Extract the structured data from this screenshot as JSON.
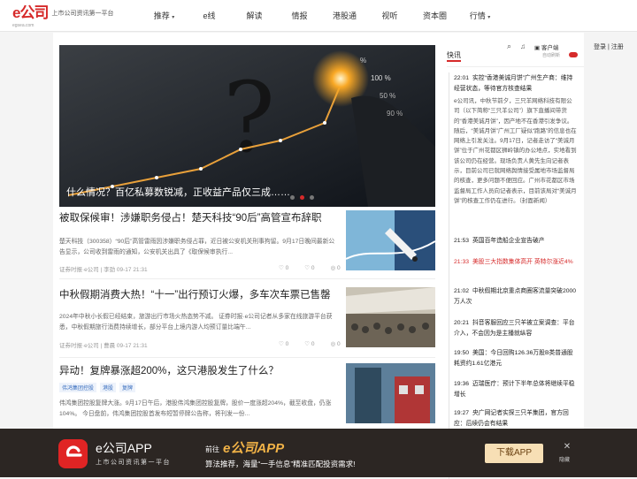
{
  "header": {
    "logo_text": "e公司",
    "logo_sub": "egsea.com",
    "slogan": "上市公司资讯第一平台",
    "nav": [
      {
        "label": "推荐",
        "caret": "▾"
      },
      {
        "label": "e线"
      },
      {
        "label": "解读"
      },
      {
        "label": "情报"
      },
      {
        "label": "港股通"
      },
      {
        "label": "视听"
      },
      {
        "label": "资本圈"
      },
      {
        "label": "行情",
        "caret": "▾"
      }
    ]
  },
  "hero": {
    "caption": "什么情况？百亿私募数锐减，正收益产品仅三成……",
    "overlay_values": [
      "%",
      "100 %",
      "50 %",
      "90 %"
    ]
  },
  "articles": [
    {
      "title": "被取保候审！涉嫌职务侵占！楚天科技“90后”高管宣布辞职",
      "tags": [],
      "summary": "楚天科技（300358）“90后”高管雷雨因涉嫌职务侵占罪，近日被公安机关刑事拘留。9月17日晚间最新公告显示，公司收到雷雨的通知，公安机关出具了《取保候审执行...",
      "meta": "证券时报·e公司 | 李劲   09-17 21:31",
      "stats": [
        "0",
        "0",
        "0"
      ]
    },
    {
      "title": "中秋假期消费大热！“十一”出行预订火爆，多车次车票已售罄",
      "tags": [],
      "summary": "2024年中秋小长假已经结束，旅游出行市场火热态势不减。 证券时报·e公司记者从多家在线旅游平台获悉，中秋假期旅行消费持续增长，部分平台上境内游人均预订量比端午...",
      "meta": "证券时报·e公司 | 曹晨   09-17 21:31",
      "stats": [
        "0",
        "0",
        "0"
      ]
    },
    {
      "title": "异动！复牌暴涨超200%，这只港股发生了什么？",
      "tags": [
        "伟鸿集团控股",
        "港股",
        "复牌"
      ],
      "summary": "伟鸿集团控股复牌大涨。9月17日午后，港股伟鸿集团控股复牌，股价一度涨超204%，截至收盘，仍涨104%。 今日盘前，伟鸿集团控股首发布短暂停牌公告称，将刊发一份...",
      "meta": "",
      "stats": []
    }
  ],
  "sidebar": {
    "heading": "快讯",
    "client_label": "客户端",
    "auto_refresh": "自动刷新",
    "login": "登录 | 注册",
    "flashes": [
      {
        "time": "22:01",
        "text": "实控“香港美诚月饼”广州生产商：维持经营状态，等待官方核查结果",
        "red": false
      }
    ],
    "flash_body": "e公司讯，中秋节前夕，三只羊网络科技有限公司（以下简称“三只羊公司”）旗下直播间带货的“香港美诚月饼”，因产地不在香港引发争议。随后，“美诚月饼”广州工厂疑似“跑路”的信息也在网络上引发关注。9月17日，记者走访了“美诚月饼”位于广州花都区狮岭镇的办公地点，实地看到该公司仍在经营。现场负责人黄先生向记者表示，目前公司已就网络舆情接受属地市场监督局的核查，更多问题不便回应。广州市花都区市场监督局工作人员向记者表示，目前该局对“美诚月饼”的核查工作仍在进行。（封面新闻）",
    "more_flashes": [
      {
        "time": "21:53",
        "text": "英国百年造船企业宣告破产",
        "red": false
      },
      {
        "time": "21:33",
        "text": "美股三大指数集体高开 英特尔涨近4%",
        "red": true
      },
      {
        "time": "21:02",
        "text": "中秋假期北京重点商圈客流量突破2000万人次",
        "red": false
      },
      {
        "time": "20:21",
        "text": "抖音客服回应三只羊被立案调查：平台介入，不会因为是主播就纵容",
        "red": false
      },
      {
        "time": "19:50",
        "text": "美国：今日回购126.36万股B类普通股 耗资约1.61亿港元",
        "red": false
      },
      {
        "time": "19:36",
        "text": "迈瑞医疗：预计下半年总体将继续平稳增长",
        "red": false
      },
      {
        "time": "19:27",
        "text": "央广网记者实探三只羊集团，官方回应：后续仍会有结果",
        "red": false
      }
    ]
  },
  "banner": {
    "app_name": "e公司APP",
    "app_slogan": "上市公司资讯第一平台",
    "promo_pre": "前往",
    "promo_app": "e公司APP",
    "promo_line": "算法推荐，海量“一手信息”精准匹配投资需求!",
    "download_label": "下载APP",
    "hide_label": "隐藏"
  },
  "colors": {
    "brand_red": "#d62a2a",
    "banner_bg": "#2c2623",
    "download_bg": "#f7dfb5"
  }
}
